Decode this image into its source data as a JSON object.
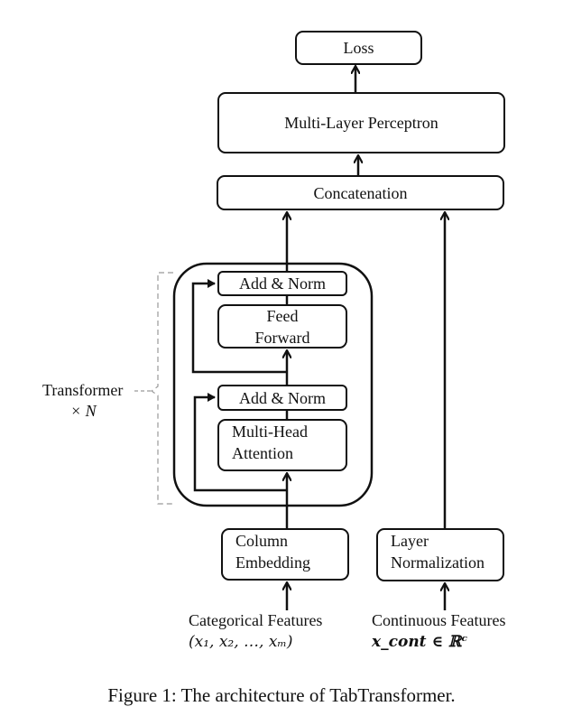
{
  "diagram": {
    "nodes": {
      "loss": "Loss",
      "mlp": "Multi-Layer Perceptron",
      "concat": "Concatenation",
      "add_norm_top": "Add & Norm",
      "feed_forward": [
        "Feed",
        "Forward"
      ],
      "add_norm_bottom": "Add & Norm",
      "mha": [
        "Multi-Head",
        "Attention"
      ],
      "column_embedding": [
        "Column",
        "Embedding"
      ],
      "layer_norm": [
        "Layer",
        "Normalization"
      ]
    },
    "transformer_block": {
      "label": "Transformer",
      "repeat": "× N"
    },
    "inputs": {
      "categorical_title": "Categorical Features",
      "categorical_math": "(x₁, x₂, …, xₘ)",
      "continuous_title": "Continuous Features",
      "continuous_math": "x_cont ∈ ℝᶜ"
    },
    "edges": [
      [
        "Categorical Features",
        "Column Embedding"
      ],
      [
        "Column Embedding",
        "Multi-Head Attention"
      ],
      [
        "Multi-Head Attention",
        "Add & Norm (bottom)"
      ],
      [
        "Column Embedding",
        "Add & Norm (bottom)",
        "residual"
      ],
      [
        "Add & Norm (bottom)",
        "Feed Forward"
      ],
      [
        "Feed Forward",
        "Add & Norm (top)"
      ],
      [
        "Add & Norm (bottom)",
        "Add & Norm (top)",
        "residual"
      ],
      [
        "Add & Norm (top)",
        "Concatenation"
      ],
      [
        "Continuous Features",
        "Layer Normalization"
      ],
      [
        "Layer Normalization",
        "Concatenation"
      ],
      [
        "Concatenation",
        "Multi-Layer Perceptron"
      ],
      [
        "Multi-Layer Perceptron",
        "Loss"
      ]
    ]
  },
  "caption": "Figure 1: The architecture of TabTransformer."
}
